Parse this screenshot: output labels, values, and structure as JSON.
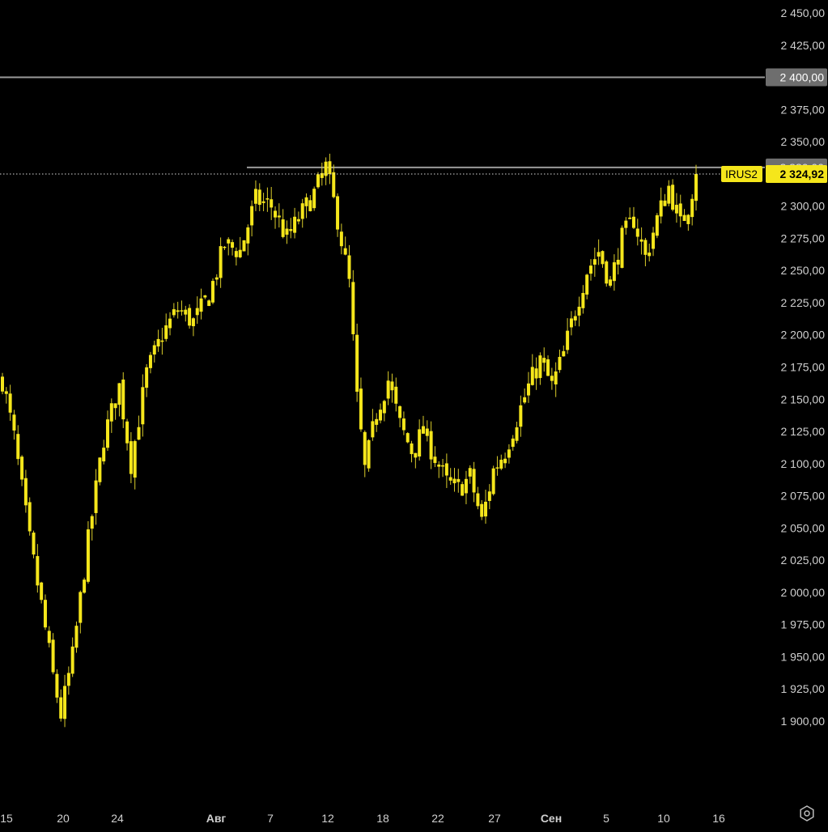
{
  "chart_data": {
    "type": "candlestick",
    "ticker": "IRUS2",
    "last_price": 2324.92,
    "last_price_label": "2 324,92",
    "ylim": [
      1890,
      2460
    ],
    "y_ticks": [
      {
        "value": 2450,
        "label": "2 450,00"
      },
      {
        "value": 2425,
        "label": "2 425,00"
      },
      {
        "value": 2400,
        "label": "2 400,00"
      },
      {
        "value": 2375,
        "label": "2 375,00"
      },
      {
        "value": 2350,
        "label": "2 350,00"
      },
      {
        "value": 2300,
        "label": "2 300,00"
      },
      {
        "value": 2275,
        "label": "2 275,00"
      },
      {
        "value": 2250,
        "label": "2 250,00"
      },
      {
        "value": 2225,
        "label": "2 225,00"
      },
      {
        "value": 2200,
        "label": "2 200,00"
      },
      {
        "value": 2175,
        "label": "2 175,00"
      },
      {
        "value": 2150,
        "label": "2 150,00"
      },
      {
        "value": 2125,
        "label": "2 125,00"
      },
      {
        "value": 2100,
        "label": "2 100,00"
      },
      {
        "value": 2075,
        "label": "2 075,00"
      },
      {
        "value": 2050,
        "label": "2 050,00"
      },
      {
        "value": 2025,
        "label": "2 025,00"
      },
      {
        "value": 2000,
        "label": "2 000,00"
      },
      {
        "value": 1975,
        "label": "1 975,00"
      },
      {
        "value": 1950,
        "label": "1 950,00"
      },
      {
        "value": 1925,
        "label": "1 925,00"
      },
      {
        "value": 1900,
        "label": "1 900,00"
      }
    ],
    "horizontal_levels": [
      {
        "value": 2400,
        "label": "2 400,00",
        "color": "#9a9a9a"
      },
      {
        "value": 2330,
        "label": "2 330,00",
        "color": "#9a9a9a"
      }
    ],
    "x_ticks": [
      {
        "label": "15",
        "pos": 0
      },
      {
        "label": "20",
        "pos": 0.25
      },
      {
        "label": "24",
        "pos": 0.45
      },
      {
        "label": "Авг",
        "pos": 0.8
      },
      {
        "label": "7",
        "pos": 1.1
      },
      {
        "label": "12",
        "pos": 1.35
      },
      {
        "label": "18",
        "pos": 1.65
      },
      {
        "label": "22",
        "pos": 1.85
      },
      {
        "label": "27",
        "pos": 2.1
      },
      {
        "label": "Сен",
        "pos": 2.37
      },
      {
        "label": "5",
        "pos": 2.63
      },
      {
        "label": "10",
        "pos": 2.87
      },
      {
        "label": "16",
        "pos": 3.15
      }
    ],
    "x_tick_bold": [
      "Авг",
      "Сен"
    ],
    "path": [
      [
        0,
        2165
      ],
      [
        3,
        2120
      ],
      [
        7,
        2040
      ],
      [
        10,
        1990
      ],
      [
        13,
        1935
      ],
      [
        15,
        1905
      ],
      [
        18,
        1950
      ],
      [
        22,
        2040
      ],
      [
        26,
        2120
      ],
      [
        30,
        2160
      ],
      [
        33,
        2100
      ],
      [
        37,
        2170
      ],
      [
        41,
        2200
      ],
      [
        45,
        2220
      ],
      [
        49,
        2210
      ],
      [
        53,
        2230
      ],
      [
        57,
        2270
      ],
      [
        61,
        2265
      ],
      [
        65,
        2305
      ],
      [
        69,
        2300
      ],
      [
        73,
        2275
      ],
      [
        77,
        2295
      ],
      [
        80,
        2310
      ],
      [
        83,
        2330
      ],
      [
        86,
        2290
      ],
      [
        89,
        2240
      ],
      [
        91,
        2150
      ],
      [
        93,
        2095
      ],
      [
        96,
        2140
      ],
      [
        99,
        2165
      ],
      [
        102,
        2130
      ],
      [
        105,
        2110
      ],
      [
        108,
        2125
      ],
      [
        111,
        2105
      ],
      [
        114,
        2085
      ],
      [
        117,
        2080
      ],
      [
        120,
        2090
      ],
      [
        123,
        2055
      ],
      [
        126,
        2095
      ],
      [
        129,
        2110
      ],
      [
        132,
        2135
      ],
      [
        135,
        2160
      ],
      [
        138,
        2180
      ],
      [
        141,
        2160
      ],
      [
        144,
        2185
      ],
      [
        147,
        2220
      ],
      [
        150,
        2250
      ],
      [
        153,
        2265
      ],
      [
        156,
        2240
      ],
      [
        159,
        2275
      ],
      [
        162,
        2290
      ],
      [
        165,
        2260
      ],
      [
        168,
        2290
      ],
      [
        171,
        2315
      ],
      [
        174,
        2285
      ],
      [
        176,
        2300
      ],
      [
        178,
        2324.92
      ]
    ],
    "n_candles": 179,
    "candle_color": "#f5e61b",
    "wick_color": "#d9cc2a"
  },
  "colors": {
    "background": "#000000",
    "axis_text": "#cfcfcf",
    "price_tag_bg": "#f5e61b",
    "price_tag_text": "#000000",
    "level_line": "#9a9a9a"
  },
  "icons": {
    "settings": "settings-gear-icon"
  }
}
